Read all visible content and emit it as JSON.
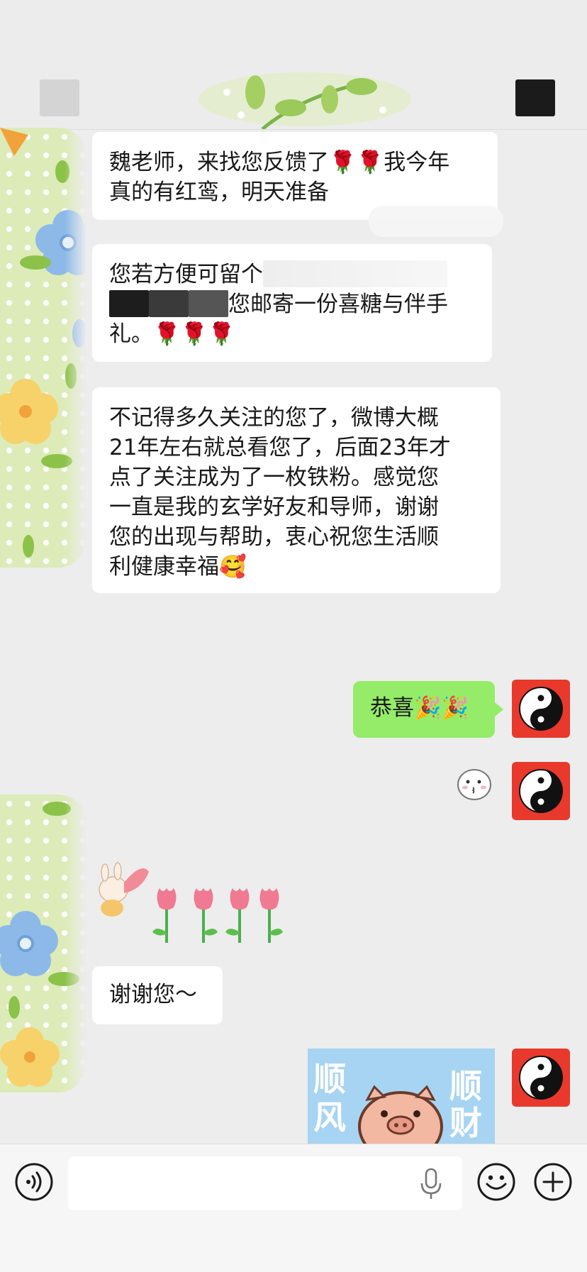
{
  "header": {
    "left_icon": "blurred-avatar-placeholder",
    "right_icon": "blurred-menu-placeholder"
  },
  "messages": [
    {
      "side": "left",
      "lines": [
        "魏老师，来找您反馈了🌹🌹我今年",
        "真的有红鸾，明天准备"
      ]
    },
    {
      "side": "left",
      "lines": [
        "您若方便可留个",
        "您邮寄一份喜糖与伴手",
        "礼。🌹🌹🌹"
      ]
    },
    {
      "side": "left",
      "lines": [
        "不记得多久关注的您了，微博大概",
        "21年左右就总看您了，后面23年才",
        "点了关注成为了一枚铁粉。感觉您",
        "一直是我的玄学好友和导师，谢谢",
        "您的出现与帮助，衷心祝您生活顺",
        "利健康幸福🥰"
      ]
    },
    {
      "side": "right",
      "text": "恭喜🎉🎉"
    },
    {
      "side": "right",
      "sticker": "kissing-face-sticker"
    },
    {
      "side": "left",
      "sticker": "tulip-bunny-sticker"
    },
    {
      "side": "left",
      "text": "谢谢您～"
    },
    {
      "side": "right",
      "sticker": "pig-sticker",
      "sticker_text": [
        "顺",
        "风",
        "顺",
        "财"
      ]
    }
  ],
  "input": {
    "placeholder": ""
  },
  "colors": {
    "background": "#ededed",
    "bubble_white": "#ffffff",
    "bubble_green": "#95ec69",
    "avatar_red": "#e8392c",
    "sticker_blue": "#a7d4f2"
  },
  "icons": {
    "voice": "voice-icon",
    "mic": "microphone-icon",
    "emoji": "smiley-icon",
    "plus": "plus-icon",
    "avatar": "yin-yang-icon"
  }
}
